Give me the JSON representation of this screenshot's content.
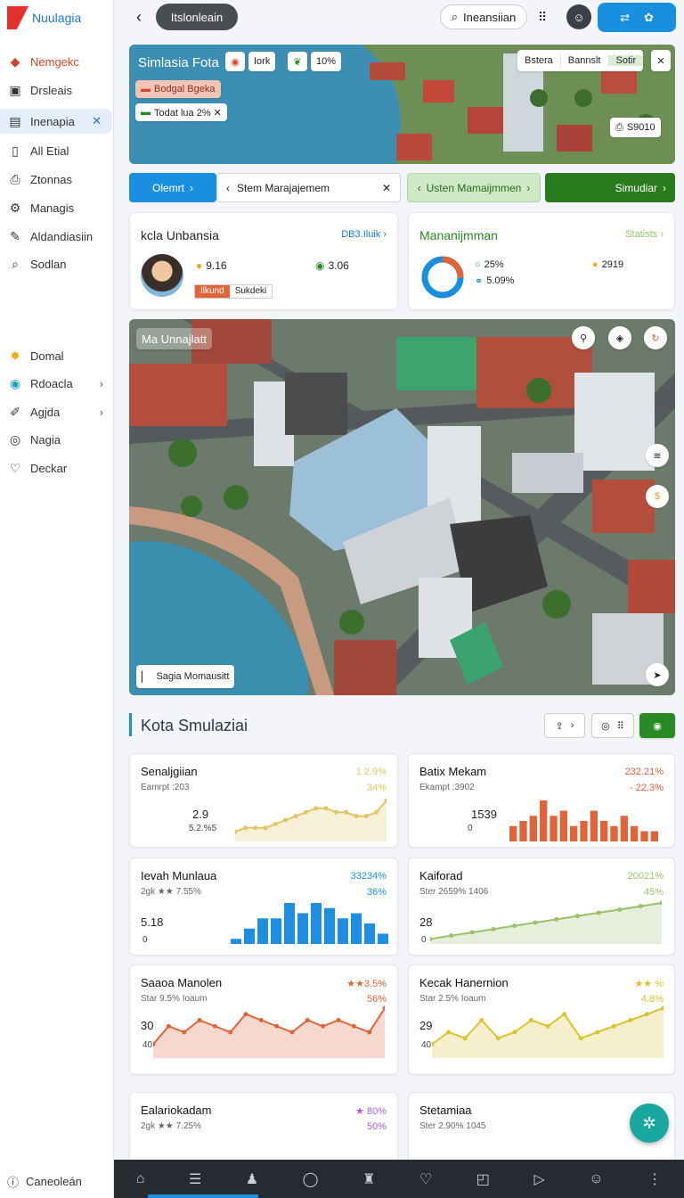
{
  "brand": {
    "name": "Nuulagia"
  },
  "sidebar": {
    "items": [
      {
        "label": "Nemgekc",
        "icon": "box-icon"
      },
      {
        "label": "Drsleais",
        "icon": "calendar-icon"
      },
      {
        "label": "Inenapia",
        "icon": "folder-icon"
      },
      {
        "label": "All Etial",
        "icon": "mail-icon"
      },
      {
        "label": "Ztonnas",
        "icon": "printer-icon"
      },
      {
        "label": "Managis",
        "icon": "gear-icon"
      },
      {
        "label": "Aldandiasiin",
        "icon": "pen-icon"
      },
      {
        "label": "Sodlan",
        "icon": "search-icon"
      },
      {
        "label": "Domal",
        "icon": "sun-icon"
      },
      {
        "label": "Rdoacla",
        "icon": "circle-icon"
      },
      {
        "label": "Agjda",
        "icon": "pencil-icon"
      },
      {
        "label": "Nagia",
        "icon": "globe-icon"
      },
      {
        "label": "Deckar",
        "icon": "heart-icon"
      }
    ],
    "footer": "Caneoleán"
  },
  "topbar": {
    "breadcrumb": "Itslonleain",
    "search": "Ineansiian"
  },
  "hero": {
    "title": "Simlasia Fota",
    "chip1": "Iork",
    "chip2": "10%",
    "tag1": "Bodgal Bgeka",
    "tag2": "Todat lua 2% ✕",
    "tabs": [
      "Bstera",
      "Bannslt",
      "Sotir"
    ],
    "badge": "S9010"
  },
  "tabs": {
    "t1": "Olemrt",
    "t2": "Stem Marajajemem",
    "t3": "Usten Mamaijmmen",
    "t4": "Simudiar"
  },
  "card1": {
    "title": "kcla Unbansia",
    "link": "DB3.Iluik",
    "v1": "9.16",
    "v2": "3.06",
    "tag1": "Ilkund",
    "tag2": "Sukdeki"
  },
  "card2": {
    "title": "Mananijmman",
    "link": "Statists",
    "v1": "25%",
    "v2": "5.09%",
    "v3": "2919"
  },
  "map": {
    "label": "Ma Unnajlatt",
    "footer": "Sagia Momausitt"
  },
  "section": {
    "title": "Kota Smulaziai"
  },
  "stats": [
    {
      "title": "Senaljgiian",
      "sub": "Eamrpt :203",
      "p1": "1 2.9%",
      "p2": "34%",
      "v": "2.9",
      "v2": "5.2.%5",
      "color": "#e2c665"
    },
    {
      "title": "Batix Mekam",
      "sub": "Ekampt :3902",
      "p1": "232.21%",
      "p2": "- 22.3%",
      "v": "1539",
      "v2": "0",
      "color": "#e0643a"
    },
    {
      "title": "Ievah Munlaua",
      "sub": "2gk ★★ 7.55%",
      "p1": "33234%",
      "p2": "36%",
      "v": "5.18",
      "v2": "0",
      "color": "#1e8fe0"
    },
    {
      "title": "Kaiforad",
      "sub": "Ster 2659% 1406",
      "p1": "20021%",
      "p2": "45%",
      "v": "28",
      "v2": "0",
      "color": "#9ac16b"
    },
    {
      "title": "Saaoa Manolen",
      "sub": "Star 9.5% Ioaum",
      "p1": "★★3.5%",
      "p2": "56%",
      "v": "30",
      "v2": "40",
      "color": "#e0643a"
    },
    {
      "title": "Kecak Hanernion",
      "sub": "Star 2.5% Ioaum",
      "p1": "★★ %",
      "p2": "4.8%",
      "v": "29",
      "v2": "40",
      "color": "#d9c431"
    },
    {
      "title": "Ealariokadam",
      "sub": "2gk ★★ 7.25%",
      "p1": "★ 80%",
      "p2": "50%",
      "color": "#b25cd9"
    },
    {
      "title": "Stetamiaa",
      "sub": "Ster 2.90% 1045",
      "p1": "",
      "p2": "",
      "color": "#1e8fe0"
    }
  ],
  "chart_data": [
    {
      "type": "area",
      "values": [
        2,
        3,
        3,
        3,
        4,
        5,
        6,
        7,
        8,
        8,
        7,
        7,
        6,
        6,
        7,
        10
      ]
    },
    {
      "type": "bar",
      "values": [
        3,
        4,
        5,
        8,
        5,
        6,
        3,
        4,
        6,
        4,
        3,
        5,
        3,
        2,
        2
      ]
    },
    {
      "type": "bar",
      "values": [
        1,
        3,
        5,
        5,
        8,
        6,
        8,
        7,
        5,
        6,
        4,
        2
      ]
    },
    {
      "type": "line",
      "values": [
        1,
        2,
        3,
        4,
        5,
        6,
        7,
        8,
        9,
        10,
        11,
        12
      ]
    },
    {
      "type": "line",
      "values": [
        2,
        5,
        4,
        6,
        5,
        4,
        7,
        6,
        5,
        4,
        6,
        5,
        6,
        5,
        4,
        8
      ]
    },
    {
      "type": "line",
      "values": [
        2,
        4,
        3,
        6,
        3,
        4,
        6,
        5,
        7,
        3,
        4,
        5,
        6,
        7,
        8
      ]
    }
  ],
  "colors": {
    "primary": "#1a8fe0",
    "green": "#2a8a26",
    "orange": "#e0643a",
    "teal": "#1aa7a0"
  }
}
